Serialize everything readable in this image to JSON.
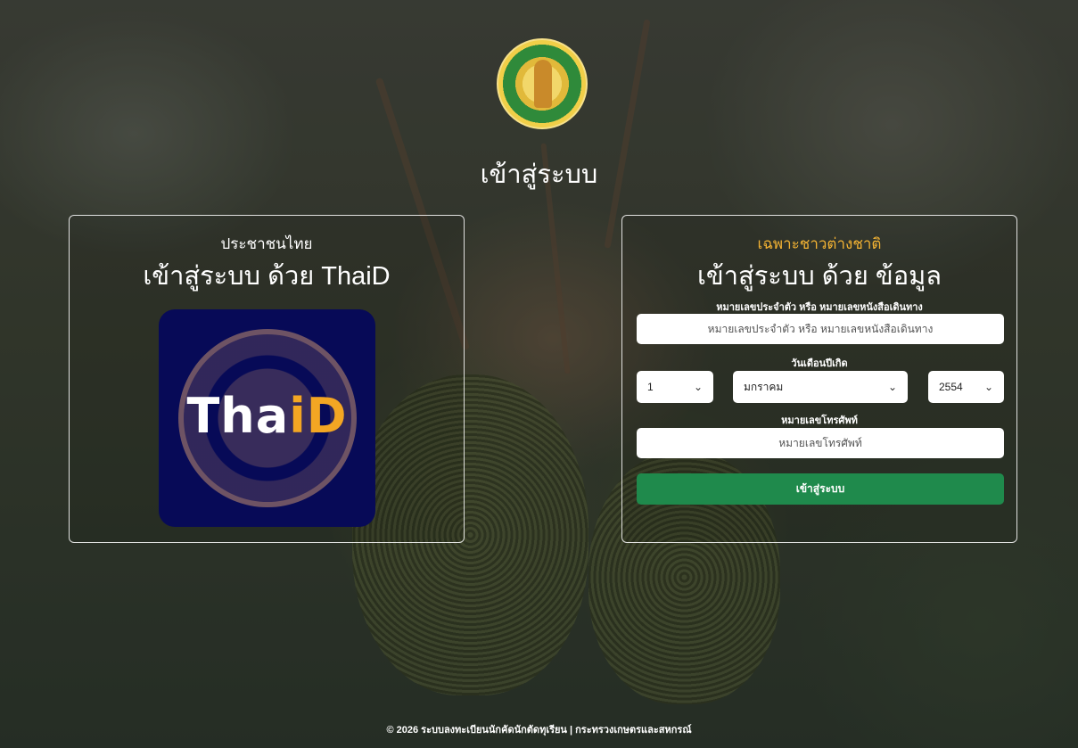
{
  "header": {
    "title": "เข้าสู่ระบบ"
  },
  "thaid_panel": {
    "subtitle": "ประชาชนไทย",
    "heading": "เข้าสู่ระบบ ด้วย ThaiD",
    "logo_text_main": "Tha",
    "logo_text_accent": "iD",
    "subtitle_color": "#ffffff"
  },
  "foreigner_panel": {
    "subtitle": "เฉพาะชาวต่างชาติ",
    "subtitle_color": "#f2b233",
    "heading": "เข้าสู่ระบบ ด้วย ข้อมูล",
    "id_label": "หมายเลขประจำตัว หรือ หมายเลขหนังสือเดินทาง",
    "id_placeholder": "หมายเลขประจำตัว หรือ หมายเลขหนังสือเดินทาง",
    "dob_label": "วันเดือนปีเกิด",
    "dob_day": "1",
    "dob_month": "มกราคม",
    "dob_year": "2554",
    "phone_label": "หมายเลขโทรศัพท์",
    "phone_placeholder": "หมายเลขโทรศัพท์",
    "login_button": "เข้าสู่ระบบ",
    "button_color": "#1f8a4c"
  },
  "footer": {
    "text": "© 2026 ระบบลงทะเบียนนักคัดนักตัดทุเรียน | กระทรวงเกษตรและสหกรณ์"
  },
  "icons": {
    "ministry_logo": "ministry-of-agriculture-seal",
    "chevron": "chevron-down-icon"
  }
}
